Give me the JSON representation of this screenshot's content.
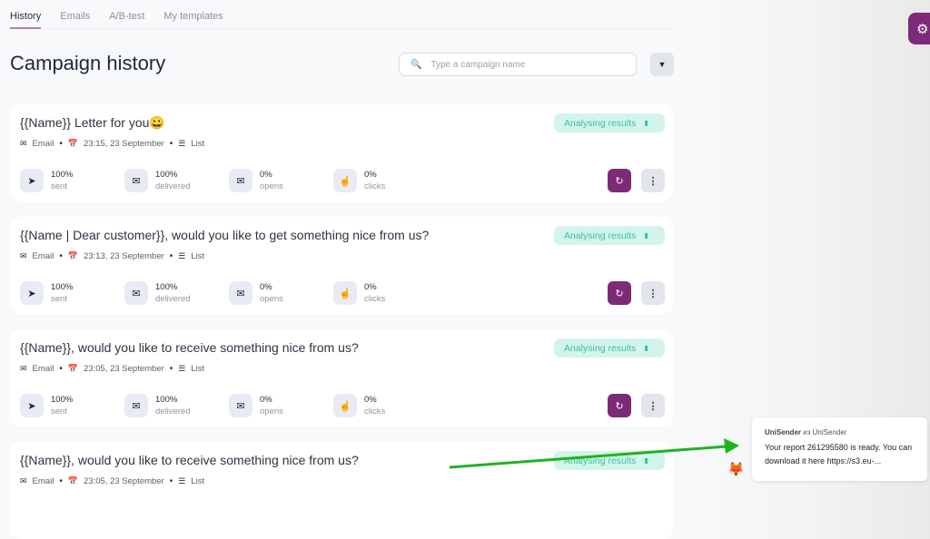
{
  "tabs": [
    {
      "label": "History",
      "active": true
    },
    {
      "label": "Emails"
    },
    {
      "label": "A/B-test"
    },
    {
      "label": "My templates"
    }
  ],
  "page_title": "Campaign history",
  "search": {
    "placeholder": "Type a campaign name",
    "value": ""
  },
  "colors": {
    "accent": "#7d2a78",
    "badge_bg": "#d3f4ec",
    "badge_text": "#3cbfa5",
    "arrow": "#1fb31f"
  },
  "campaigns": [
    {
      "title": "{{Name}} Letter for you😀",
      "type": "Email",
      "date": "23:15, 23 September",
      "list": "List",
      "status": "Analysing results",
      "stats": [
        {
          "value": "100%",
          "label": "sent"
        },
        {
          "value": "100%",
          "label": "delivered"
        },
        {
          "value": "0%",
          "label": "opens"
        },
        {
          "value": "0%",
          "label": "clicks"
        }
      ]
    },
    {
      "title": "{{Name | Dear customer}}, would you like to get something nice from us?",
      "type": "Email",
      "date": "23:13, 23 September",
      "list": "List",
      "status": "Analysing results",
      "stats": [
        {
          "value": "100%",
          "label": "sent"
        },
        {
          "value": "100%",
          "label": "delivered"
        },
        {
          "value": "0%",
          "label": "opens"
        },
        {
          "value": "0%",
          "label": "clicks"
        }
      ]
    },
    {
      "title": "{{Name}}, would you like to receive something nice from us?",
      "type": "Email",
      "date": "23:05, 23 September",
      "list": "List",
      "status": "Analysing results",
      "stats": [
        {
          "value": "100%",
          "label": "sent"
        },
        {
          "value": "100%",
          "label": "delivered"
        },
        {
          "value": "0%",
          "label": "opens"
        },
        {
          "value": "0%",
          "label": "clicks"
        }
      ]
    },
    {
      "title": "{{Name}}, would you like to receive something nice from us?",
      "type": "Email",
      "date": "23:05, 23 September",
      "list": "List",
      "status": "Analysing results",
      "stats": []
    }
  ],
  "notification": {
    "sender": "UniSender",
    "via": "из",
    "source": "UniSender",
    "message": "Your report 261295580 is ready. You can download it here https://s3.eu-..."
  }
}
